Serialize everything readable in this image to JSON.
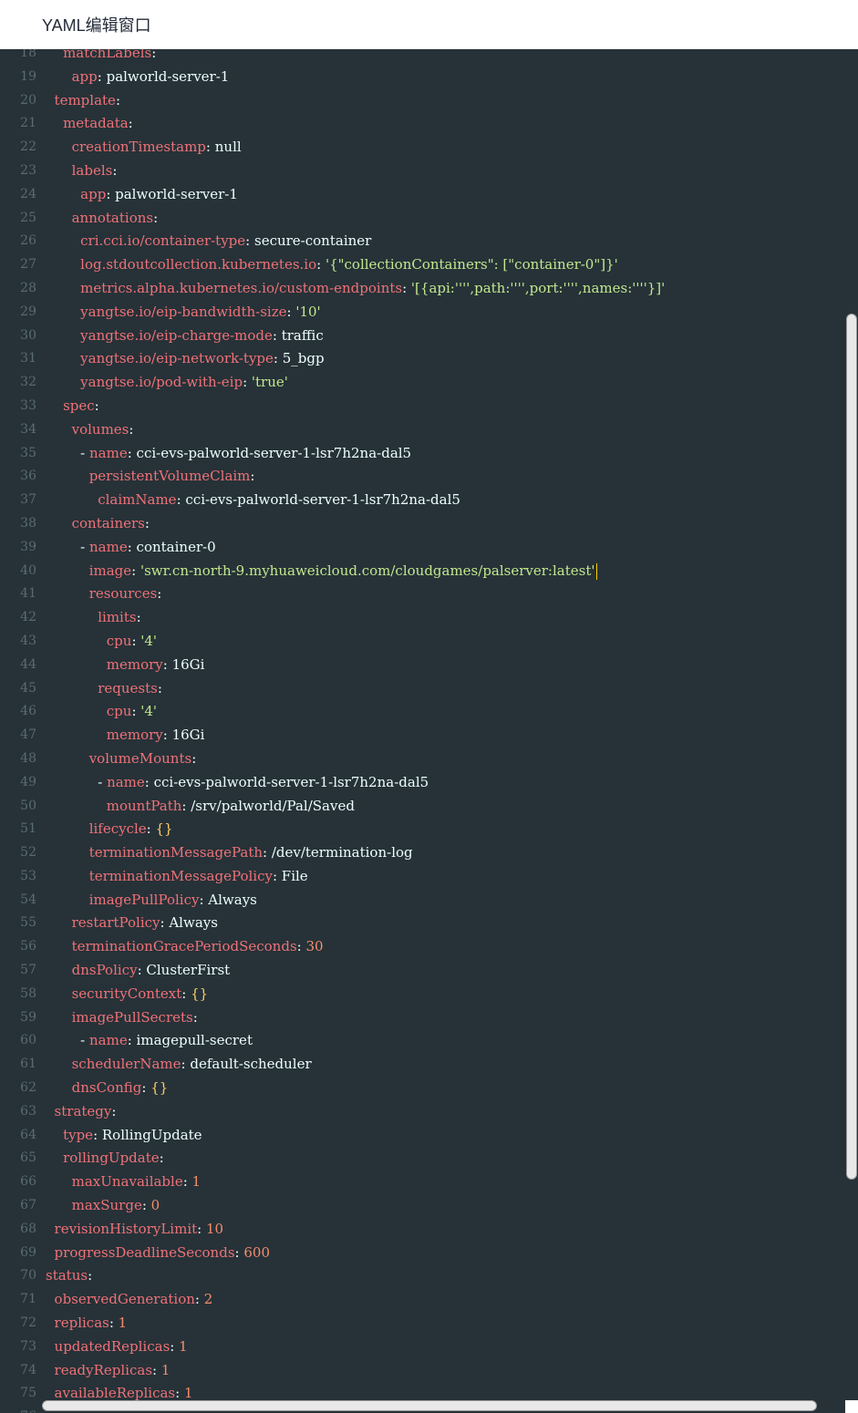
{
  "window": {
    "title": "YAML编辑窗口"
  },
  "editor": {
    "lines": [
      {
        "n": "18",
        "indent": 4,
        "key": "matchLabels",
        "sep": ":",
        "val": "",
        "vtype": "v"
      },
      {
        "n": "19",
        "indent": 6,
        "key": "app",
        "sep": ": ",
        "val": "palworld-server-1",
        "vtype": "v"
      },
      {
        "n": "20",
        "indent": 2,
        "key": "template",
        "sep": ":",
        "val": "",
        "vtype": "v"
      },
      {
        "n": "21",
        "indent": 4,
        "key": "metadata",
        "sep": ":",
        "val": "",
        "vtype": "v"
      },
      {
        "n": "22",
        "indent": 6,
        "key": "creationTimestamp",
        "sep": ": ",
        "val": "null",
        "vtype": "v"
      },
      {
        "n": "23",
        "indent": 6,
        "key": "labels",
        "sep": ":",
        "val": "",
        "vtype": "v"
      },
      {
        "n": "24",
        "indent": 8,
        "key": "app",
        "sep": ": ",
        "val": "palworld-server-1",
        "vtype": "v"
      },
      {
        "n": "25",
        "indent": 6,
        "key": "annotations",
        "sep": ":",
        "val": "",
        "vtype": "v"
      },
      {
        "n": "26",
        "indent": 8,
        "key": "cri.cci.io/container-type",
        "sep": ": ",
        "val": "secure-container",
        "vtype": "v"
      },
      {
        "n": "27",
        "indent": 8,
        "key": "log.stdoutcollection.kubernetes.io",
        "sep": ": ",
        "val": "'{\"collectionContainers\": [\"container-0\"]}'",
        "vtype": "s"
      },
      {
        "n": "28",
        "indent": 8,
        "key": "metrics.alpha.kubernetes.io/custom-endpoints",
        "sep": ": ",
        "val": "'[{api:'''',path:'''',port:'''',names:''''}]'",
        "vtype": "s"
      },
      {
        "n": "29",
        "indent": 8,
        "key": "yangtse.io/eip-bandwidth-size",
        "sep": ": ",
        "val": "'10'",
        "vtype": "s"
      },
      {
        "n": "30",
        "indent": 8,
        "key": "yangtse.io/eip-charge-mode",
        "sep": ": ",
        "val": "traffic",
        "vtype": "v"
      },
      {
        "n": "31",
        "indent": 8,
        "key": "yangtse.io/eip-network-type",
        "sep": ": ",
        "val": "5_bgp",
        "vtype": "v"
      },
      {
        "n": "32",
        "indent": 8,
        "key": "yangtse.io/pod-with-eip",
        "sep": ": ",
        "val": "'true'",
        "vtype": "s"
      },
      {
        "n": "33",
        "indent": 4,
        "key": "spec",
        "sep": ":",
        "val": "",
        "vtype": "v"
      },
      {
        "n": "34",
        "indent": 6,
        "key": "volumes",
        "sep": ":",
        "val": "",
        "vtype": "v"
      },
      {
        "n": "35",
        "indent": 8,
        "dash": true,
        "key": "name",
        "sep": ": ",
        "val": "cci-evs-palworld-server-1-lsr7h2na-dal5",
        "vtype": "v"
      },
      {
        "n": "36",
        "indent": 10,
        "key": "persistentVolumeClaim",
        "sep": ":",
        "val": "",
        "vtype": "v"
      },
      {
        "n": "37",
        "indent": 12,
        "key": "claimName",
        "sep": ": ",
        "val": "cci-evs-palworld-server-1-lsr7h2na-dal5",
        "vtype": "v"
      },
      {
        "n": "38",
        "indent": 6,
        "key": "containers",
        "sep": ":",
        "val": "",
        "vtype": "v"
      },
      {
        "n": "39",
        "indent": 8,
        "dash": true,
        "key": "name",
        "sep": ": ",
        "val": "container-0",
        "vtype": "v"
      },
      {
        "n": "40",
        "indent": 10,
        "key": "image",
        "sep": ": ",
        "val": "'swr.cn-north-9.myhuaweicloud.com/cloudgames/palserver:latest'",
        "vtype": "s",
        "caret": true
      },
      {
        "n": "41",
        "indent": 10,
        "key": "resources",
        "sep": ":",
        "val": "",
        "vtype": "v"
      },
      {
        "n": "42",
        "indent": 12,
        "key": "limits",
        "sep": ":",
        "val": "",
        "vtype": "v"
      },
      {
        "n": "43",
        "indent": 14,
        "key": "cpu",
        "sep": ": ",
        "val": "'4'",
        "vtype": "s"
      },
      {
        "n": "44",
        "indent": 14,
        "key": "memory",
        "sep": ": ",
        "val": "16Gi",
        "vtype": "v"
      },
      {
        "n": "45",
        "indent": 12,
        "key": "requests",
        "sep": ":",
        "val": "",
        "vtype": "v"
      },
      {
        "n": "46",
        "indent": 14,
        "key": "cpu",
        "sep": ": ",
        "val": "'4'",
        "vtype": "s"
      },
      {
        "n": "47",
        "indent": 14,
        "key": "memory",
        "sep": ": ",
        "val": "16Gi",
        "vtype": "v"
      },
      {
        "n": "48",
        "indent": 10,
        "key": "volumeMounts",
        "sep": ":",
        "val": "",
        "vtype": "v"
      },
      {
        "n": "49",
        "indent": 12,
        "dash": true,
        "key": "name",
        "sep": ": ",
        "val": "cci-evs-palworld-server-1-lsr7h2na-dal5",
        "vtype": "v"
      },
      {
        "n": "50",
        "indent": 14,
        "key": "mountPath",
        "sep": ": ",
        "val": "/srv/palworld/Pal/Saved",
        "vtype": "v"
      },
      {
        "n": "51",
        "indent": 10,
        "key": "lifecycle",
        "sep": ": ",
        "val": "{}",
        "vtype": "b"
      },
      {
        "n": "52",
        "indent": 10,
        "key": "terminationMessagePath",
        "sep": ": ",
        "val": "/dev/termination-log",
        "vtype": "v"
      },
      {
        "n": "53",
        "indent": 10,
        "key": "terminationMessagePolicy",
        "sep": ": ",
        "val": "File",
        "vtype": "v"
      },
      {
        "n": "54",
        "indent": 10,
        "key": "imagePullPolicy",
        "sep": ": ",
        "val": "Always",
        "vtype": "v"
      },
      {
        "n": "55",
        "indent": 6,
        "key": "restartPolicy",
        "sep": ": ",
        "val": "Always",
        "vtype": "v"
      },
      {
        "n": "56",
        "indent": 6,
        "key": "terminationGracePeriodSeconds",
        "sep": ": ",
        "val": "30",
        "vtype": "n"
      },
      {
        "n": "57",
        "indent": 6,
        "key": "dnsPolicy",
        "sep": ": ",
        "val": "ClusterFirst",
        "vtype": "v"
      },
      {
        "n": "58",
        "indent": 6,
        "key": "securityContext",
        "sep": ": ",
        "val": "{}",
        "vtype": "b"
      },
      {
        "n": "59",
        "indent": 6,
        "key": "imagePullSecrets",
        "sep": ":",
        "val": "",
        "vtype": "v"
      },
      {
        "n": "60",
        "indent": 8,
        "dash": true,
        "key": "name",
        "sep": ": ",
        "val": "imagepull-secret",
        "vtype": "v"
      },
      {
        "n": "61",
        "indent": 6,
        "key": "schedulerName",
        "sep": ": ",
        "val": "default-scheduler",
        "vtype": "v"
      },
      {
        "n": "62",
        "indent": 6,
        "key": "dnsConfig",
        "sep": ": ",
        "val": "{}",
        "vtype": "b"
      },
      {
        "n": "63",
        "indent": 2,
        "key": "strategy",
        "sep": ":",
        "val": "",
        "vtype": "v"
      },
      {
        "n": "64",
        "indent": 4,
        "key": "type",
        "sep": ": ",
        "val": "RollingUpdate",
        "vtype": "v"
      },
      {
        "n": "65",
        "indent": 4,
        "key": "rollingUpdate",
        "sep": ":",
        "val": "",
        "vtype": "v"
      },
      {
        "n": "66",
        "indent": 6,
        "key": "maxUnavailable",
        "sep": ": ",
        "val": "1",
        "vtype": "n"
      },
      {
        "n": "67",
        "indent": 6,
        "key": "maxSurge",
        "sep": ": ",
        "val": "0",
        "vtype": "n"
      },
      {
        "n": "68",
        "indent": 2,
        "key": "revisionHistoryLimit",
        "sep": ": ",
        "val": "10",
        "vtype": "n"
      },
      {
        "n": "69",
        "indent": 2,
        "key": "progressDeadlineSeconds",
        "sep": ": ",
        "val": "600",
        "vtype": "n"
      },
      {
        "n": "70",
        "indent": 0,
        "key": "status",
        "sep": ":",
        "val": "",
        "vtype": "v"
      },
      {
        "n": "71",
        "indent": 2,
        "key": "observedGeneration",
        "sep": ": ",
        "val": "2",
        "vtype": "n"
      },
      {
        "n": "72",
        "indent": 2,
        "key": "replicas",
        "sep": ": ",
        "val": "1",
        "vtype": "n"
      },
      {
        "n": "73",
        "indent": 2,
        "key": "updatedReplicas",
        "sep": ": ",
        "val": "1",
        "vtype": "n"
      },
      {
        "n": "74",
        "indent": 2,
        "key": "readyReplicas",
        "sep": ": ",
        "val": "1",
        "vtype": "n"
      },
      {
        "n": "75",
        "indent": 2,
        "key": "availableReplicas",
        "sep": ": ",
        "val": "1",
        "vtype": "n"
      },
      {
        "n": "76",
        "indent": 2,
        "key": "",
        "sep": "",
        "val": "",
        "vtype": "v"
      }
    ]
  },
  "colors": {
    "editor_bg": "#263238",
    "key": "#f07178",
    "string": "#c3e88d",
    "number": "#f78c6c",
    "brace": "#ffcb6b",
    "caret": "#ffcc00"
  }
}
